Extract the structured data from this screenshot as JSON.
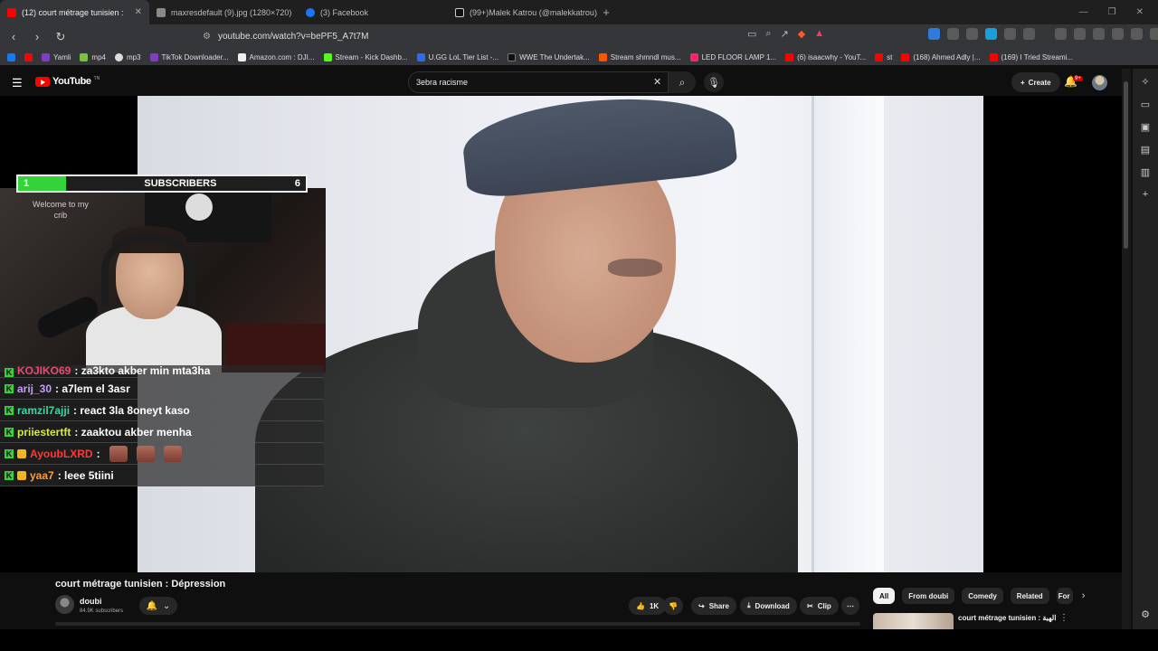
{
  "tabs": [
    {
      "label": "(12) court métrage tunisien :",
      "color": "#ff0000",
      "active": true
    },
    {
      "label": "maxresdefault (9).jpg (1280×720)",
      "color": "#888888",
      "active": false
    },
    {
      "label": "(3) Facebook",
      "color": "#1877f2",
      "active": false
    },
    {
      "label": "(99+)Malek Katrou (@malekkatrou) |",
      "color": "#111111",
      "active": false
    }
  ],
  "address_bar": {
    "url": "youtube.com/watch?v=bePF5_A7t7M"
  },
  "bookmarks": [
    {
      "label": "",
      "color": "#1877f2"
    },
    {
      "label": "",
      "color": "#ff0000"
    },
    {
      "label": "Yamli",
      "color": "#7b3fbf"
    },
    {
      "label": "mp4",
      "color": "#7cc242"
    },
    {
      "label": "mp3",
      "color": "#dddddd"
    },
    {
      "label": "TikTok Downloader...",
      "color": "#7b3fbf"
    },
    {
      "label": "Amazon.com : DJI...",
      "color": "#eeeeee"
    },
    {
      "label": "Stream - Kick Dashb...",
      "color": "#53fc18"
    },
    {
      "label": "U.GG LoL Tier List -...",
      "color": "#2b6cf6"
    },
    {
      "label": "WWE The Undertak...",
      "color": "#111111"
    },
    {
      "label": "Stream shmndl mus...",
      "color": "#ff5500"
    },
    {
      "label": "LED FLOOR LAMP 1...",
      "color": "#ff2266"
    },
    {
      "label": "(6) isaacwhy - YouT...",
      "color": "#ff0000"
    },
    {
      "label": "st",
      "color": "#ff0000"
    },
    {
      "label": "(168) Ahmed Adly |...",
      "color": "#ff0000"
    },
    {
      "label": "(169) I Tried Streami...",
      "color": "#ff0000"
    }
  ],
  "youtube": {
    "logo": "YouTube",
    "logo_sup": "TN",
    "search_value": "3ebra racisme",
    "create_label": "Create",
    "notif_count": "9+"
  },
  "overlay": {
    "goal_current": "1",
    "goal_title": "SUBSCRIBERS",
    "goal_target": "6",
    "goal_fraction": 0.1667,
    "webcam_text_line1": "Welcome to my",
    "webcam_text_line2": "crib"
  },
  "chat": [
    {
      "user": "KOJIKO69",
      "color": "#e94b6f",
      "msg": " : za3kto akber min mta3ha",
      "badge": "kick",
      "partial": true
    },
    {
      "user": "arij_30",
      "color": "#c79bff",
      "msg": " : a7lem el 3asr",
      "badge": "kick"
    },
    {
      "user": "ramzil7ajji",
      "color": "#3cd6a6",
      "msg": " : react 3la 8oneyt kaso",
      "badge": "kick"
    },
    {
      "user": "priiestertft",
      "color": "#d6e84a",
      "msg": " : zaaktou akber menha",
      "badge": "kick"
    },
    {
      "user": "AyoubLXRD",
      "color": "#ff3838",
      "msg": " :",
      "badge": "kick-crown",
      "emotes": 3
    },
    {
      "user": "yaa7",
      "color": "#ff9b3c",
      "msg": " : leee 5tiini",
      "badge": "kick-crown"
    }
  ],
  "video": {
    "title": "court métrage tunisien : Dépression",
    "channel": "doubi",
    "subscribers": "84.9K subscribers",
    "likes": "1K",
    "share": "Share",
    "download": "Download",
    "clip": "Clip"
  },
  "chips": [
    "All",
    "From doubi",
    "Comedy",
    "Related",
    "For"
  ],
  "recommendation": {
    "title": "court métrage tunisien : الهبة"
  }
}
